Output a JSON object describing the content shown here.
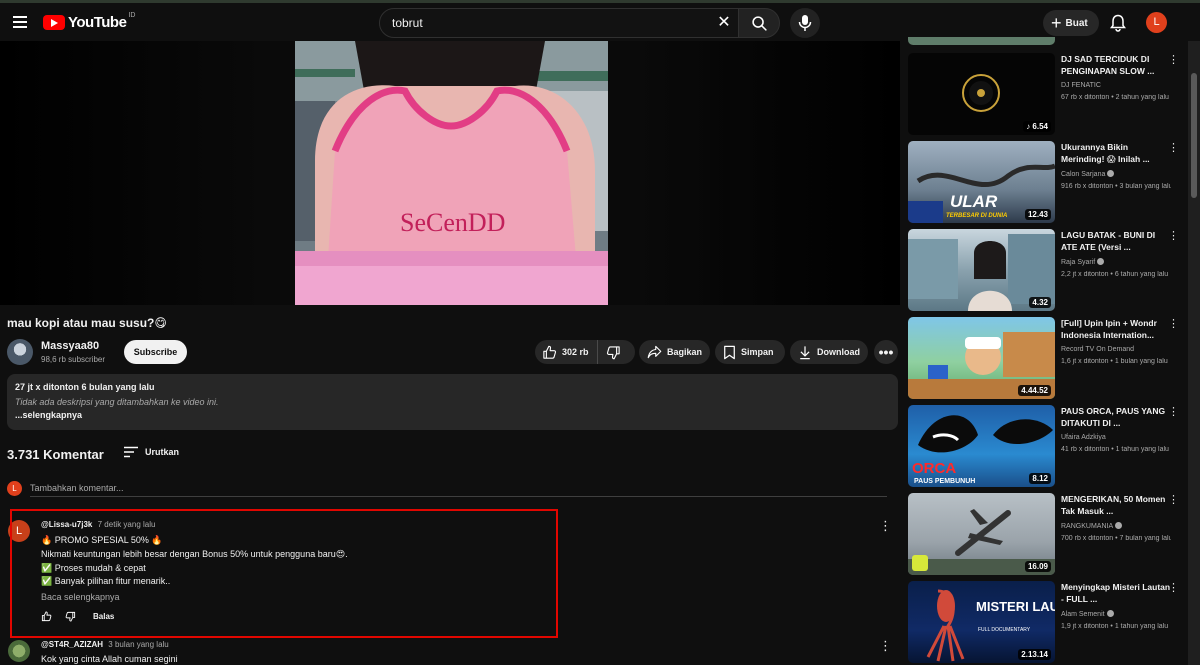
{
  "header": {
    "logo_text": "YouTube",
    "logo_region": "ID",
    "search_value": "tobrut",
    "create_label": "Buat",
    "avatar_letter": "L"
  },
  "video": {
    "title": "mau kopi atau mau susu?😋",
    "channel_name": "Massyaa80",
    "channel_subs": "98,6 rb subscriber",
    "subscribe_label": "Subscribe",
    "likes": "302 rb",
    "share_label": "Bagikan",
    "save_label": "Simpan",
    "download_label": "Download",
    "shirt_text": "SeCenDD"
  },
  "description": {
    "stats": "27 jt x ditonton  6 bulan yang lalu",
    "text": "Tidak ada deskripsi yang ditambahkan ke video ini.",
    "more_label": "...selengkapnya"
  },
  "comments": {
    "count_label": "3.731 Komentar",
    "sort_label": "Urutkan",
    "add_placeholder": "Tambahkan komentar...",
    "add_avatar_letter": "L",
    "items": [
      {
        "avatar_letter": "L",
        "user": "@Lissa-u7j3k",
        "time": "7 detik yang lalu",
        "lines": [
          "🔥 PROMO SPESIAL 50% 🔥",
          "Nikmati keuntungan lebih besar dengan Bonus 50% untuk pengguna baru😍.",
          "✅ Proses mudah & cepat",
          "✅ Banyak pilihan fitur menarik.."
        ],
        "read_more": "Baca selengkapnya",
        "reply_label": "Balas"
      },
      {
        "user": "@ST4R_AZIZAH",
        "time": "3 bulan yang lalu",
        "lines": [
          "Kok yang cinta Allah cuman segini"
        ]
      }
    ]
  },
  "recommendations": [
    {
      "title": "DJ SAD TERCIDUK DI PENGINAPAN SLOW ...",
      "channel": "DJ FENATIC",
      "meta": "67 rb x ditonton • 2 tahun yang lalu",
      "duration": "6.54",
      "verified": false
    },
    {
      "title": "Ukurannya Bikin Merinding! 😱 Inilah ...",
      "channel": "Calon Sarjana",
      "meta": "916 rb x ditonton • 3 bulan yang lalu",
      "duration": "12.43",
      "verified": true,
      "thumb_title": "ULAR",
      "thumb_sub": "TERBESAR DI DUNIA"
    },
    {
      "title": "LAGU BATAK - BUNI DI ATE ATE (Versi ...",
      "channel": "Raja Syarif",
      "meta": "2,2 jt x ditonton • 6 tahun yang lalu",
      "duration": "4.32",
      "verified": true
    },
    {
      "title": "[Full] Upin Ipin + Wondr Indonesia Internation...",
      "channel": "Record TV On Demand",
      "meta": "1,6 jt x ditonton • 1 bulan yang lalu",
      "duration": "4.44.52",
      "verified": false
    },
    {
      "title": "PAUS ORCA, PAUS YANG DITAKUTI DI ...",
      "channel": "Ufaira Adzkiya",
      "meta": "41 rb x ditonton • 1 tahun yang lalu",
      "duration": "8.12",
      "verified": false,
      "thumb_title": "ORCA",
      "thumb_sub": "PAUS PEMBUNUH"
    },
    {
      "title": "MENGERIKAN, 50 Momen Tak Masuk ...",
      "channel": "RANGKUMANIA",
      "meta": "700 rb x ditonton • 7 bulan yang lalu",
      "duration": "16.09",
      "verified": true
    },
    {
      "title": "Menyingkap Misteri Lautan - FULL ...",
      "channel": "Alam Semenit",
      "meta": "1,9 jt x ditonton • 1 tahun yang lalu",
      "duration": "2.13.14",
      "verified": true,
      "thumb_title": "MISTERI LAUTAN",
      "thumb_sub": "FULL DOCUMENTARY"
    }
  ],
  "colors": {
    "background": "#0f0f0f",
    "accent_red": "#ff0000",
    "highlight_border": "#e10600",
    "pill_bg": "#272727"
  }
}
